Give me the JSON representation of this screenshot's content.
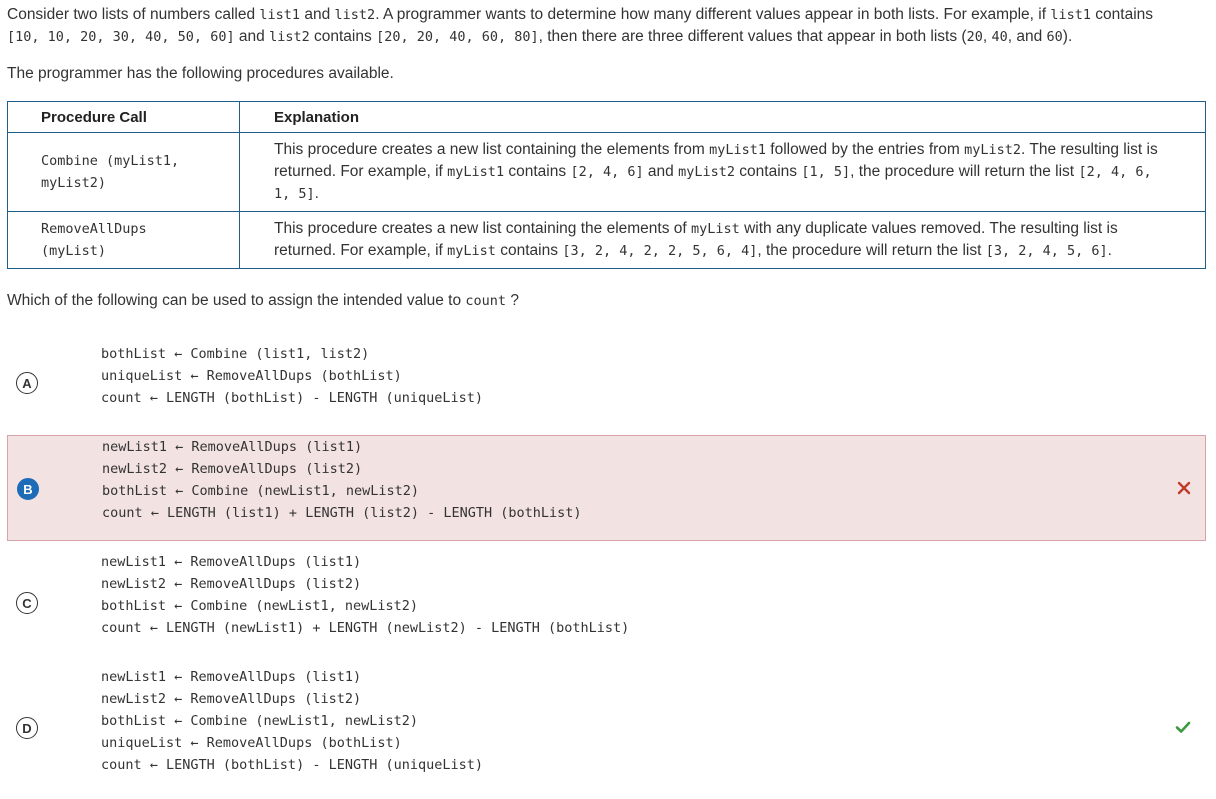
{
  "intro": {
    "line1": [
      {
        "t": "Consider two lists of numbers called ",
        "c": false
      },
      {
        "t": "list1",
        "c": true
      },
      {
        "t": " and ",
        "c": false
      },
      {
        "t": "list2",
        "c": true
      },
      {
        "t": ". A programmer wants to determine how many different values appear in both lists. For example, if ",
        "c": false
      },
      {
        "t": "list1",
        "c": true
      },
      {
        "t": " contains",
        "c": false
      }
    ],
    "line2": [
      {
        "t": "[10, 10, 20, 30, 40, 50, 60]",
        "c": true
      },
      {
        "t": " and ",
        "c": false
      },
      {
        "t": "list2",
        "c": true
      },
      {
        "t": " contains ",
        "c": false
      },
      {
        "t": "[20, 20, 40, 60, 80]",
        "c": true
      },
      {
        "t": ", then there are three different values that appear in both lists (",
        "c": false
      },
      {
        "t": "20",
        "c": true
      },
      {
        "t": ", ",
        "c": false
      },
      {
        "t": "40",
        "c": true
      },
      {
        "t": ", and ",
        "c": false
      },
      {
        "t": "60",
        "c": true
      },
      {
        "t": ").",
        "c": false
      }
    ]
  },
  "available_text": "The programmer has the following procedures available.",
  "table": {
    "headers": [
      "Procedure Call",
      "Explanation"
    ],
    "rows": [
      {
        "call": [
          "Combine (myList1,",
          "myList2)"
        ],
        "explanation": [
          {
            "t": "This procedure creates a new list containing the elements from ",
            "c": false
          },
          {
            "t": "myList1",
            "c": true
          },
          {
            "t": " followed by the entries from ",
            "c": false
          },
          {
            "t": "myList2",
            "c": true
          },
          {
            "t": ". The resulting list is returned. For example, if ",
            "c": false
          },
          {
            "t": "myList1",
            "c": true
          },
          {
            "t": " contains ",
            "c": false
          },
          {
            "t": "[2, 4, 6]",
            "c": true
          },
          {
            "t": " and ",
            "c": false
          },
          {
            "t": "myList2",
            "c": true
          },
          {
            "t": " contains ",
            "c": false
          },
          {
            "t": "[1, 5]",
            "c": true
          },
          {
            "t": ", the procedure will return the list ",
            "c": false
          },
          {
            "t": "[2, 4, 6, 1, 5]",
            "c": true
          },
          {
            "t": ".",
            "c": false
          }
        ]
      },
      {
        "call": [
          "RemoveAllDups",
          "(myList)"
        ],
        "explanation": [
          {
            "t": "This procedure creates a new list containing the elements of ",
            "c": false
          },
          {
            "t": "myList",
            "c": true
          },
          {
            "t": " with any duplicate values removed. The resulting list is returned. For example, if ",
            "c": false
          },
          {
            "t": "myList",
            "c": true
          },
          {
            "t": " contains ",
            "c": false
          },
          {
            "t": "[3, 2, 4, 2, 2, 5, 6, 4]",
            "c": true
          },
          {
            "t": ", the procedure will return the list ",
            "c": false
          },
          {
            "t": "[3, 2, 4, 5, 6]",
            "c": true
          },
          {
            "t": ".",
            "c": false
          }
        ]
      }
    ]
  },
  "question": [
    {
      "t": "Which of the following can be used to assign the intended value to ",
      "c": false
    },
    {
      "t": "count",
      "c": true
    },
    {
      "t": " ?",
      "c": false
    }
  ],
  "options": [
    {
      "letter": "A",
      "status": "none",
      "code": [
        "bothList ← Combine (list1, list2)",
        "uniqueList ← RemoveAllDups (bothList)",
        "count ← LENGTH (bothList) - LENGTH (uniqueList)"
      ]
    },
    {
      "letter": "B",
      "status": "incorrect-selected",
      "code": [
        "newList1 ← RemoveAllDups (list1)",
        "newList2 ← RemoveAllDups (list2)",
        "bothList ← Combine (newList1, newList2)",
        "count ← LENGTH (list1) + LENGTH (list2) - LENGTH (bothList)"
      ]
    },
    {
      "letter": "C",
      "status": "none",
      "code": [
        "newList1 ← RemoveAllDups (list1)",
        "newList2 ← RemoveAllDups (list2)",
        "bothList ← Combine (newList1, newList2)",
        "count ← LENGTH (newList1) + LENGTH (newList2) - LENGTH (bothList)"
      ]
    },
    {
      "letter": "D",
      "status": "correct",
      "code": [
        "newList1 ← RemoveAllDups (list1)",
        "newList2 ← RemoveAllDups (list2)",
        "bothList ← Combine (newList1, newList2)",
        "uniqueList ← RemoveAllDups (bothList)",
        "count ← LENGTH (bothList) - LENGTH (uniqueList)"
      ]
    }
  ],
  "colors": {
    "table_border": "#1f5d8a",
    "selected_wrong_bg": "#f3e2e2",
    "selected_wrong_border": "#d7a3a8",
    "selected_letter": "#1e6bb8",
    "wrong_mark": "#c0392b",
    "correct_mark": "#3c9a3f"
  }
}
